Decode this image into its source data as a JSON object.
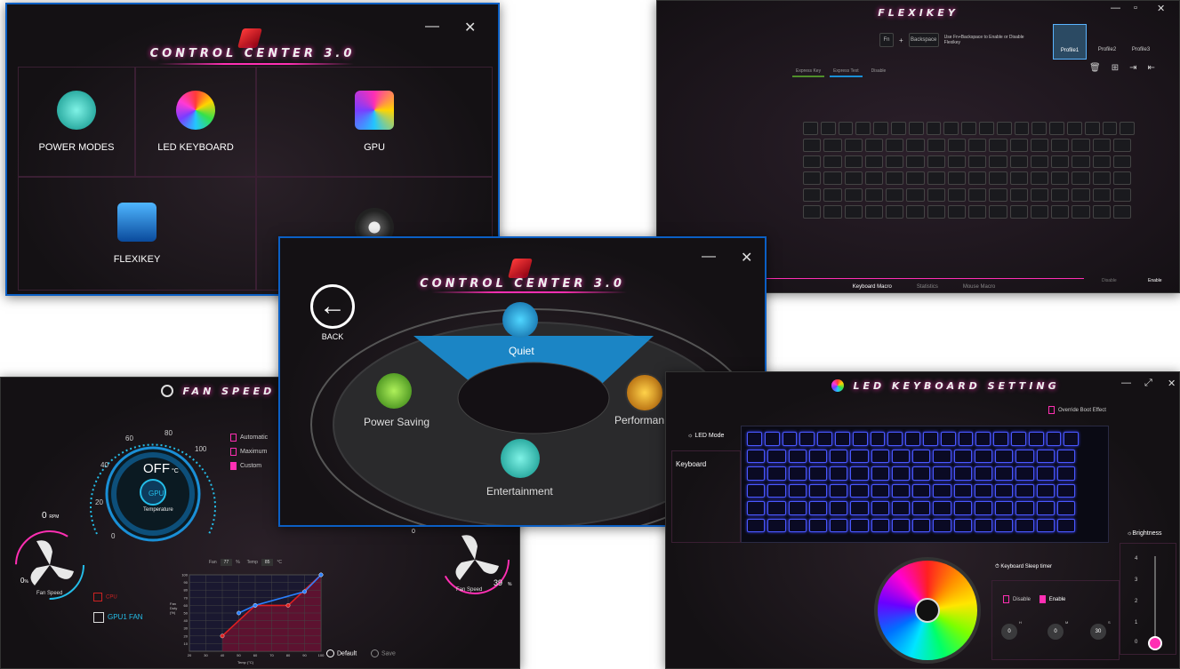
{
  "control_center_main": {
    "brand": "CONTROL CENTER 3.0",
    "tiles": [
      {
        "label": "POWER MODES",
        "icon": "power-modes-icon"
      },
      {
        "label": "LED KEYBOARD",
        "icon": "led-keyboard-icon"
      },
      {
        "label": "GPU",
        "icon": "gpu-icon"
      },
      {
        "label": "FLEXIKEY",
        "icon": "flexikey-icon"
      },
      {
        "label": "",
        "icon": "fan-icon"
      }
    ],
    "minimize": "—",
    "close": "✕"
  },
  "flexikey": {
    "brand": "FLEXIKEY",
    "hint_key1": "Fn",
    "hint_key2": "Backspace",
    "hint_text": "Use Fn+Backspace to Enable or Disable Flexikey",
    "profiles": [
      "Profile1",
      "Profile2",
      "Profile3"
    ],
    "tabs": [
      "Express Key",
      "Express Text",
      "Disable"
    ],
    "bottom_tabs": [
      "Keyboard Macro",
      "Statistics",
      "Mouse Macro"
    ],
    "disable_label": "Disable",
    "enable_label": "Enable"
  },
  "power_modes": {
    "brand": "CONTROL CENTER 3.0",
    "back_label": "BACK",
    "modes": {
      "quiet": "Quiet",
      "power_saving": "Power Saving",
      "performance": "Performan",
      "entertainment": "Entertainment"
    }
  },
  "fan_speed": {
    "brand": "FAN SPEED",
    "gauge_value": "OFF",
    "gauge_unit": "°C",
    "gpu_label": "GPU",
    "temperature_label": "Temperature",
    "gauge_ticks": [
      "0",
      "20",
      "40",
      "60",
      "80",
      "100"
    ],
    "modes": [
      {
        "label": "Automatic",
        "on": false
      },
      {
        "label": "Maximum",
        "on": false
      },
      {
        "label": "Custom",
        "on": true
      }
    ],
    "left_fan": {
      "rpm_value": "0",
      "rpm_unit": "RPM",
      "percent": "0",
      "unit": "%",
      "label": "Fan Speed"
    },
    "right_fan": {
      "percent": "39",
      "unit": "%",
      "label": "Fan Speed",
      "top_value": "0"
    },
    "cpu_label": "CPU",
    "gpu1_fan_label": "GPU1 FAN",
    "fan_field_label": "Fan",
    "fan_field_value": "77",
    "fan_field_unit": "%",
    "temp_field_label": "Temp",
    "temp_field_value": "85",
    "temp_field_unit": "°C",
    "default_label": "Default",
    "save_label": "Save"
  },
  "led_keyboard": {
    "brand": "LED KEYBOARD SETTING",
    "override_label": "Override Boot Effect",
    "led_mode_label": "LED Mode",
    "keyboard_label": "Keyboard",
    "sleep_timer_label": "Keyboard Sleep timer",
    "disable_label": "Disable",
    "enable_label": "Enable",
    "timer": [
      {
        "value": "0",
        "unit": "H"
      },
      {
        "value": "0",
        "unit": "M"
      },
      {
        "value": "30",
        "unit": "S"
      }
    ],
    "brightness_label": "Brightness",
    "brightness_levels": [
      "4",
      "3",
      "2",
      "1",
      "0"
    ],
    "brightness_value": 0
  },
  "fan_chart": {
    "type": "line",
    "xlabel": "Temp (°C)",
    "ylabel": "Fan Duty (%)",
    "x_ticks": [
      "20",
      "30",
      "40",
      "50",
      "60",
      "70",
      "80",
      "90",
      "100"
    ],
    "y_ticks": [
      "100",
      "90",
      "80",
      "70",
      "60",
      "50",
      "40",
      "30",
      "20",
      "10"
    ],
    "xlim": [
      20,
      100
    ],
    "ylim": [
      0,
      100
    ],
    "series": [
      {
        "color": "#e02020",
        "points": [
          [
            40,
            20
          ],
          [
            60,
            60
          ],
          [
            80,
            60
          ],
          [
            100,
            100
          ]
        ]
      },
      {
        "color": "#2a80ff",
        "points": [
          [
            50,
            50
          ],
          [
            60,
            60
          ],
          [
            90,
            78
          ],
          [
            100,
            100
          ]
        ]
      }
    ]
  },
  "chart_data": {
    "type": "line",
    "xlabel": "Temp (°C)",
    "ylabel": "Fan Duty (%)",
    "x": [
      20,
      30,
      40,
      50,
      60,
      70,
      80,
      90,
      100
    ],
    "xlim": [
      20,
      100
    ],
    "ylim": [
      0,
      100
    ],
    "series": [
      {
        "x": [
          40,
          60,
          80,
          100
        ],
        "values": [
          20,
          60,
          60,
          100
        ]
      },
      {
        "x": [
          50,
          60,
          90,
          100
        ],
        "values": [
          50,
          60,
          78,
          100
        ]
      }
    ]
  },
  "colors": {
    "accent": "#ff2fb3",
    "blue_key": "#4a58ff",
    "quiet": "#1a8fd6"
  }
}
